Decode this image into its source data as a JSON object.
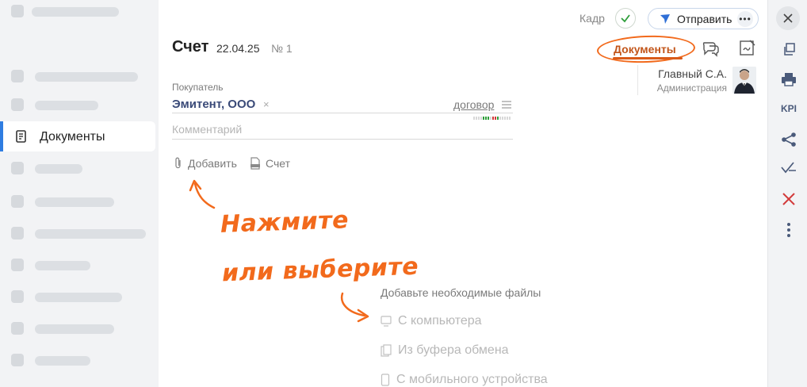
{
  "sidebar": {
    "active_item": "Документы"
  },
  "header": {
    "frame_label": "Кадр",
    "send_label": "Отправить",
    "more_label": "•••",
    "title": "Счет",
    "date": "22.04.25",
    "number": "№ 1"
  },
  "tabs": {
    "documents": "Документы"
  },
  "author": {
    "name": "Главный С.А.",
    "role": "Администрация"
  },
  "form": {
    "buyer_label": "Покупатель",
    "buyer_value": "Эмитент, ООО",
    "clear": "×",
    "contract_link": "договор",
    "comment_placeholder": "Комментарий"
  },
  "attachments": {
    "add_label": "Добавить",
    "invoice_label": "Счет"
  },
  "hint": {
    "line1": "Нажмите",
    "line2": "или выберите"
  },
  "drop": {
    "title": "Добавьте необходимые файлы",
    "options": [
      "С компьютера",
      "Из буфера обмена",
      "С мобильного устройства"
    ]
  },
  "toolbar": {
    "kpi": "KPI"
  },
  "colors": {
    "accent_orange": "#f26a1c",
    "tab_text": "#c2551a",
    "buyer_text": "#3a4a78",
    "send_icon": "#2f6fd6",
    "check": "#2e9e3a",
    "delete": "#d23a3a"
  }
}
